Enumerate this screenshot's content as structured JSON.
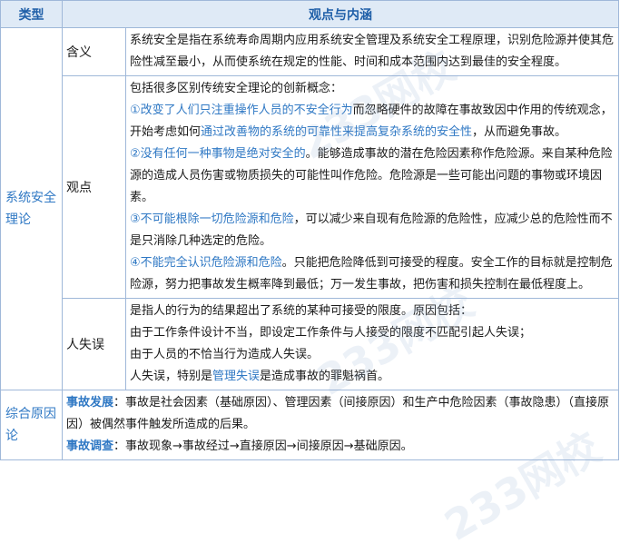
{
  "header": {
    "col_type": "类型",
    "col_view": "观点与内涵"
  },
  "section1": {
    "type": "系统安全理论",
    "rows": {
      "meaning": {
        "label": "含义",
        "text": "系统安全是指在系统寿命周期内应用系统安全管理及系统安全工程原理，识别危险源并使其危险性减至最小，从而使系统在规定的性能、时间和成本范围内达到最佳的安全程度。"
      },
      "view": {
        "label": "观点",
        "intro": "包括很多区别传统安全理论的创新概念：",
        "p1_a": "①改变了人们只注重操作人员的不安全行为",
        "p1_b": "而忽略硬件的故障在事故致因中作用的传统观念，开始考虑如何",
        "p1_c": "通过改善物的系统的可靠性来提高复杂系统的安全性",
        "p1_d": "，从而避免事故。",
        "p2_a": "②没有任何一种事物是绝对安全的",
        "p2_b": "。能够造成事故的潜在危险因素称作危险源。来自某种危险源的造成人员伤害或物质损失的可能性叫作危险。危险源是一些可能出问题的事物或环境因素。",
        "p3_a": "③不可能根除一切危险源和危险",
        "p3_b": "，可以减少来自现有危险源的危险性，应减少总的危险性而不是只消除几种选定的危险。",
        "p4_a": "④不能完全认识危险源和危险",
        "p4_b": "。只能把危险降低到可接受的程度。安全工作的目标就是控制危险源，努力把事故发生概率降到最低；万一发生事故，把伤害和损失控制在最低程度上。"
      },
      "human": {
        "label": "人失误",
        "line1": "是指人的行为的结果超出了系统的某种可接受的限度。原因包括：",
        "line2": "由于工作条件设计不当，即设定工作条件与人接受的限度不匹配引起人失误；",
        "line3": "由于人员的不恰当行为造成人失误。",
        "line4_a": "人失误，特别是",
        "line4_b": "管理失误",
        "line4_c": "是造成事故的罪魁祸首。"
      }
    }
  },
  "section2": {
    "type": "综合原因论",
    "dev_label": "事故发展",
    "dev_text": "：事故是社会因素（基础原因）、管理因素（间接原因）和生产中危险因素（事故隐患）（直接原因）被偶然事件触发所造成的后果。",
    "inv_label": "事故调查",
    "inv_text": "：事故现象→事故经过→直接原因→间接原因→基础原因。"
  },
  "watermark": "233网校"
}
